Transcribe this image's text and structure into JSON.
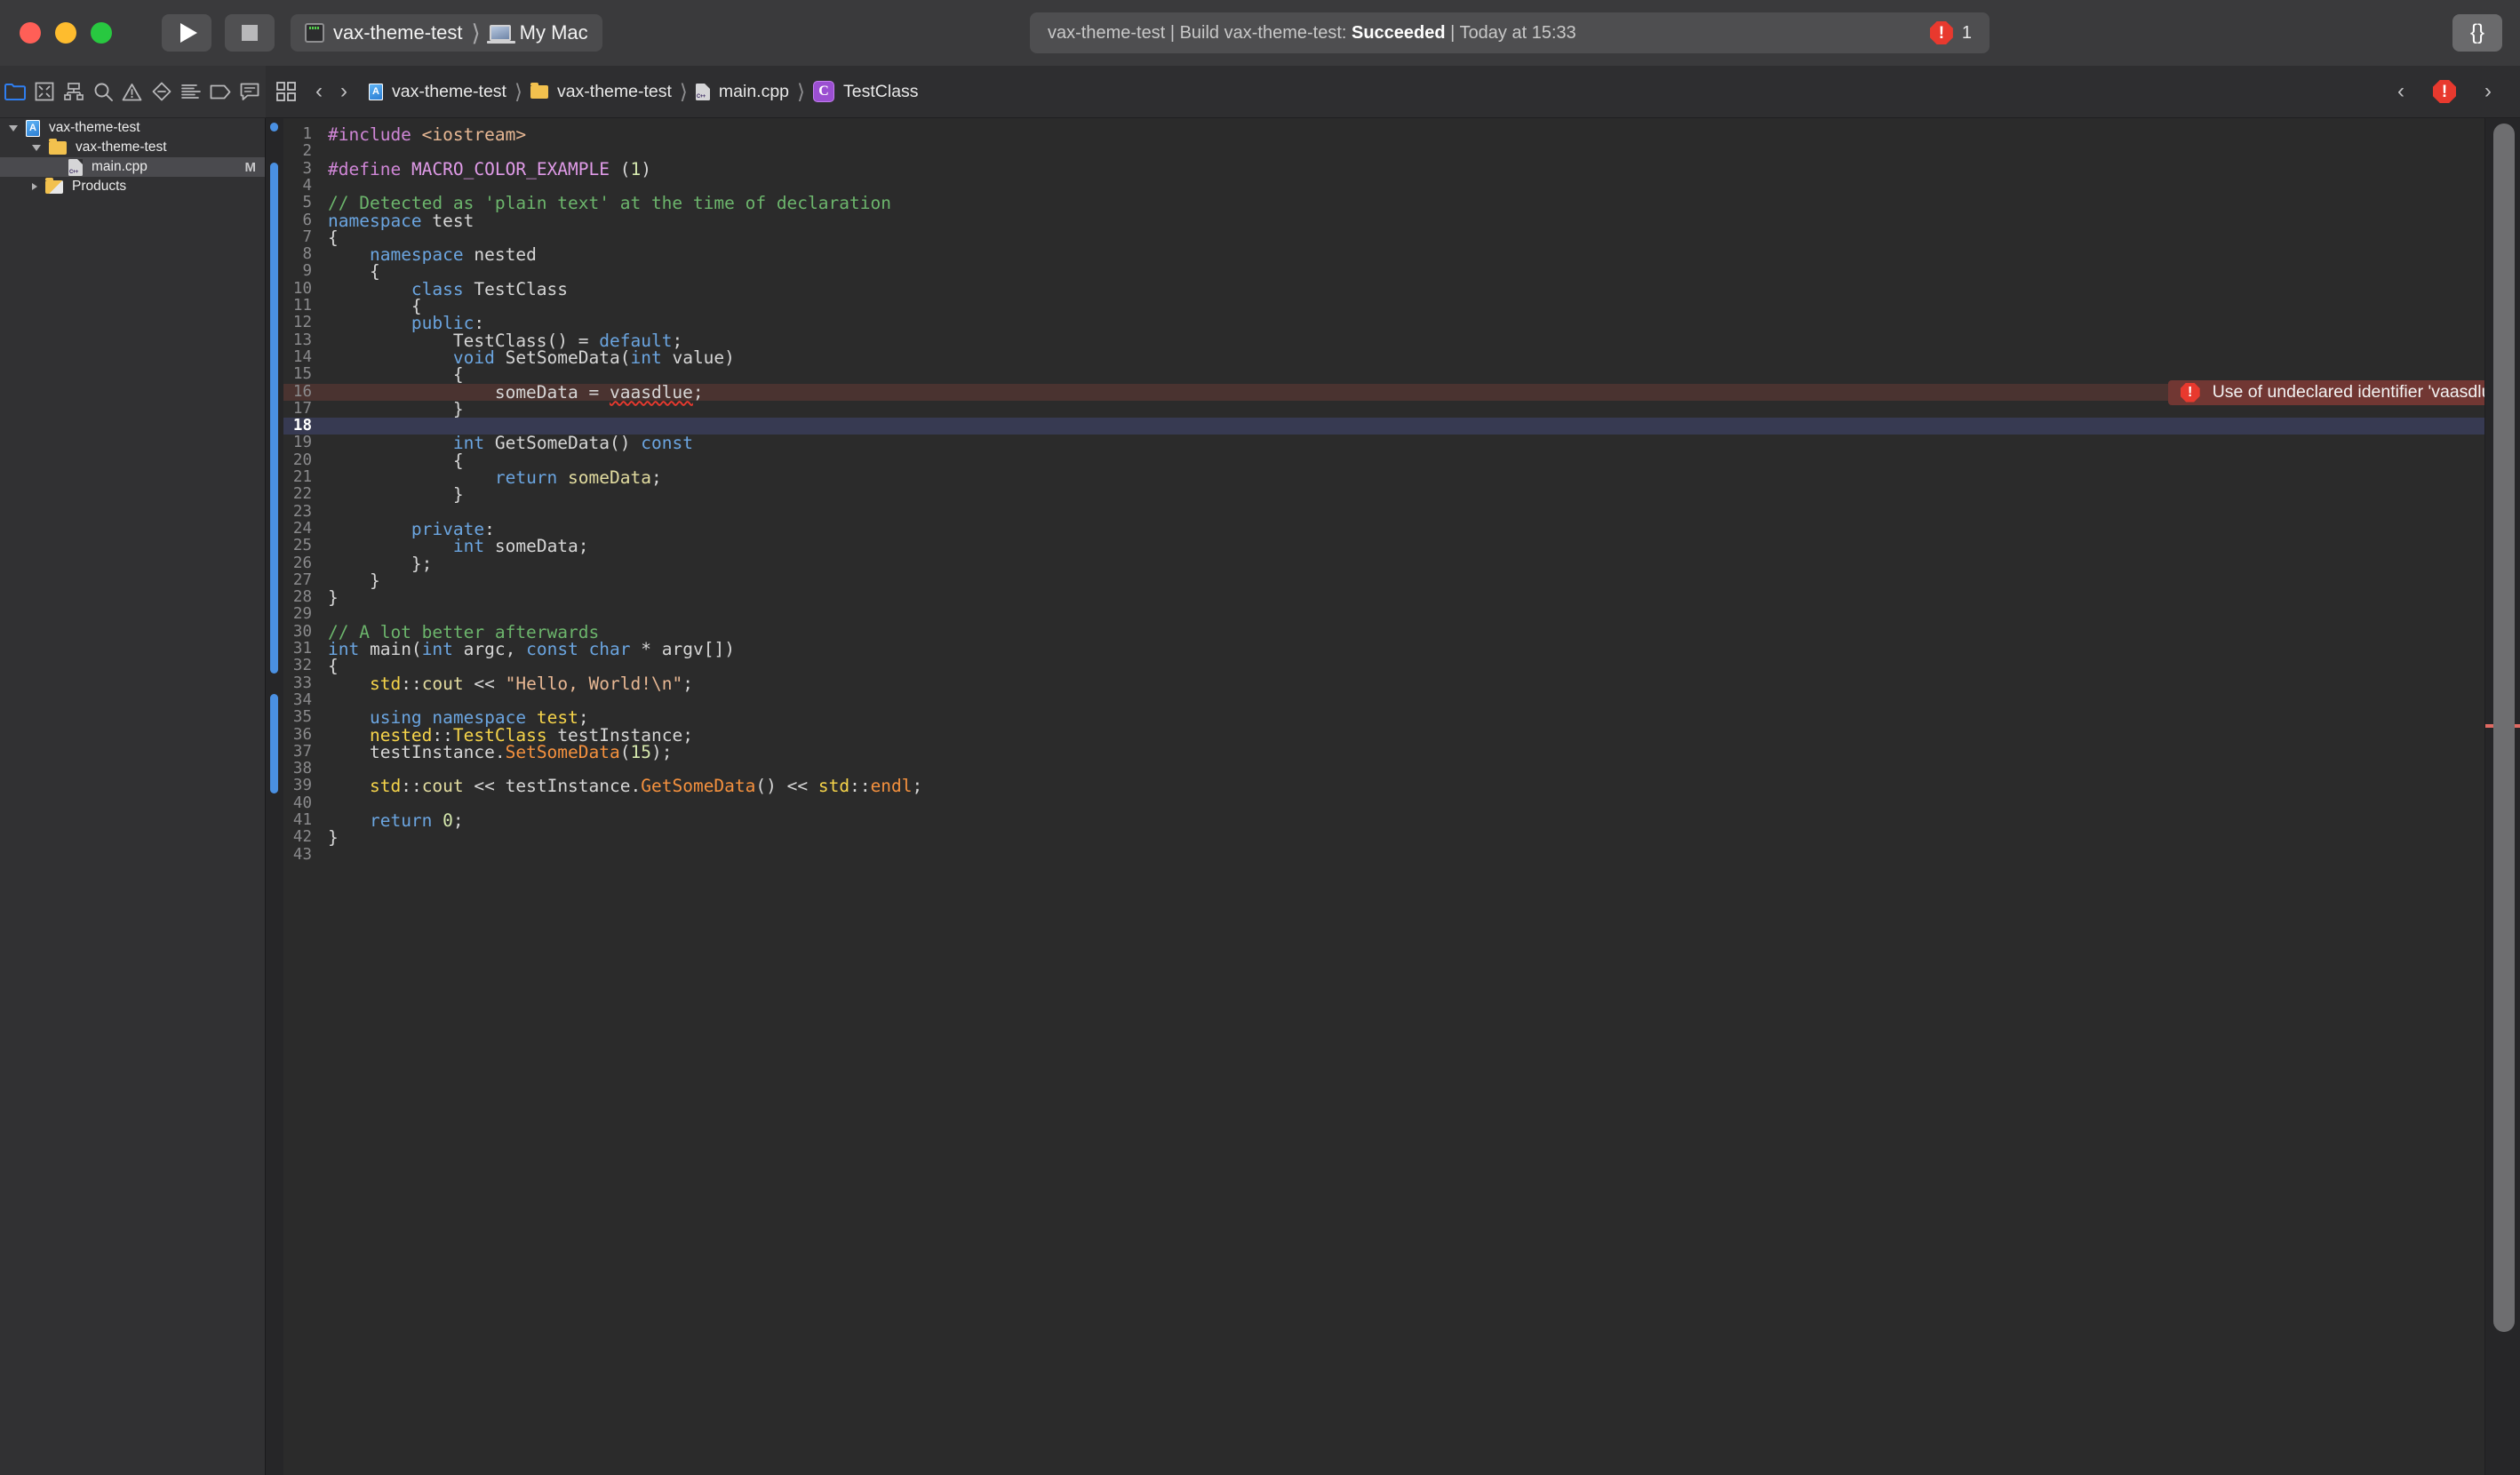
{
  "titlebar": {
    "run_label": "Run",
    "stop_label": "Stop",
    "scheme": "vax-theme-test",
    "scheme_separator": "⟩",
    "destination": "My Mac",
    "library_label": "{}"
  },
  "status": {
    "scheme": "vax-theme-test",
    "action": "Build vax-theme-test:",
    "result": "Succeeded",
    "time": "Today at 15:33",
    "error_count": "1",
    "error_glyph": "!"
  },
  "nav_toolbar": {
    "items": [
      {
        "icon": "folder-icon",
        "label": "Project navigator",
        "active": true
      },
      {
        "icon": "source-control-icon",
        "label": "Source control navigator",
        "active": false
      },
      {
        "icon": "symbol-navigator-icon",
        "label": "Symbol navigator",
        "active": false
      },
      {
        "icon": "search-icon",
        "label": "Find navigator",
        "active": false
      },
      {
        "icon": "warning-triangle-icon",
        "label": "Issue navigator",
        "active": false
      },
      {
        "icon": "test-diamond-icon",
        "label": "Test navigator",
        "active": false
      },
      {
        "icon": "debug-list-icon",
        "label": "Debug navigator",
        "active": false
      },
      {
        "icon": "breakpoint-tag-icon",
        "label": "Breakpoint navigator",
        "active": false
      },
      {
        "icon": "report-speech-icon",
        "label": "Report navigator",
        "active": false
      }
    ]
  },
  "navigator": {
    "items": [
      {
        "label": "vax-theme-test",
        "icon": "xcode-project-icon",
        "indent": 0,
        "disclosure": "open",
        "selected": false,
        "status": ""
      },
      {
        "label": "vax-theme-test",
        "icon": "folder-icon",
        "indent": 1,
        "disclosure": "open",
        "selected": false,
        "status": ""
      },
      {
        "label": "main.cpp",
        "icon": "cpp-file-icon",
        "indent": 2,
        "disclosure": "none",
        "selected": true,
        "status": "M"
      },
      {
        "label": "Products",
        "icon": "products-folder-icon",
        "indent": 1,
        "disclosure": "closed",
        "selected": false,
        "status": ""
      }
    ]
  },
  "jumpbar": {
    "related_items_label": "Related Items",
    "back_label": "‹",
    "forward_label": "›",
    "crumbs": [
      {
        "label": "vax-theme-test",
        "icon": "xcode-project-icon"
      },
      {
        "label": "vax-theme-test",
        "icon": "folder-icon"
      },
      {
        "label": "main.cpp",
        "icon": "cpp-file-icon"
      },
      {
        "label": "TestClass",
        "icon": "class-symbol-icon"
      }
    ],
    "separator": "⟩",
    "prev_issue_label": "‹",
    "next_issue_label": "›",
    "issue_glyph": "!"
  },
  "editor": {
    "error_message": "Use of undeclared identifier 'vaasdlue'",
    "error_glyph": "!",
    "current_line": 18,
    "error_line": 16,
    "total_lines": 43,
    "colors": {
      "background": "#2b2b2b",
      "keyword": "#6ba5e0",
      "preprocessor": "#cf86d6",
      "macro": "#e09be8",
      "string": "#e8b894",
      "comment": "#6cb56c",
      "number": "#d5e8ad",
      "type": "#f6d44a",
      "function": "#f5913e",
      "member": "#e2dca0",
      "plain": "#d6d6d6",
      "current_line_bg": "#373a52",
      "error_line_bg": "#4a3330",
      "change_bar": "#4a90e2"
    },
    "lines": [
      {
        "n": 1,
        "tokens": [
          [
            "pp",
            "#include"
          ],
          [
            "pl",
            " "
          ],
          [
            "str",
            "<iostream>"
          ]
        ]
      },
      {
        "n": 2,
        "tokens": []
      },
      {
        "n": 3,
        "tokens": [
          [
            "pp",
            "#define"
          ],
          [
            "pl",
            " "
          ],
          [
            "mac",
            "MACRO_COLOR_EXAMPLE"
          ],
          [
            "pl",
            " ("
          ],
          [
            "num",
            "1"
          ],
          [
            "pl",
            ")"
          ]
        ]
      },
      {
        "n": 4,
        "tokens": []
      },
      {
        "n": 5,
        "tokens": [
          [
            "cmt",
            "// Detected as 'plain text' at the time of declaration"
          ]
        ]
      },
      {
        "n": 6,
        "tokens": [
          [
            "k",
            "namespace"
          ],
          [
            "pl",
            " test"
          ]
        ]
      },
      {
        "n": 7,
        "tokens": [
          [
            "pl",
            "{"
          ]
        ]
      },
      {
        "n": 8,
        "tokens": [
          [
            "pl",
            "    "
          ],
          [
            "k",
            "namespace"
          ],
          [
            "pl",
            " nested"
          ]
        ]
      },
      {
        "n": 9,
        "tokens": [
          [
            "pl",
            "    {"
          ]
        ]
      },
      {
        "n": 10,
        "tokens": [
          [
            "pl",
            "        "
          ],
          [
            "k",
            "class"
          ],
          [
            "pl",
            " TestClass"
          ]
        ]
      },
      {
        "n": 11,
        "tokens": [
          [
            "pl",
            "        {"
          ]
        ]
      },
      {
        "n": 12,
        "tokens": [
          [
            "pl",
            "        "
          ],
          [
            "k",
            "public"
          ],
          [
            "pl",
            ":"
          ]
        ]
      },
      {
        "n": 13,
        "tokens": [
          [
            "pl",
            "            TestClass() = "
          ],
          [
            "k",
            "default"
          ],
          [
            "pl",
            ";"
          ]
        ]
      },
      {
        "n": 14,
        "tokens": [
          [
            "pl",
            "            "
          ],
          [
            "k",
            "void"
          ],
          [
            "pl",
            " SetSomeData("
          ],
          [
            "k",
            "int"
          ],
          [
            "pl",
            " value)"
          ]
        ]
      },
      {
        "n": 15,
        "tokens": [
          [
            "pl",
            "            {"
          ]
        ]
      },
      {
        "n": 16,
        "tokens": [
          [
            "pl",
            "                someData = "
          ],
          [
            "errsq",
            "vaasdlue"
          ],
          [
            "pl",
            ";"
          ]
        ]
      },
      {
        "n": 17,
        "tokens": [
          [
            "pl",
            "            }"
          ]
        ]
      },
      {
        "n": 18,
        "tokens": []
      },
      {
        "n": 19,
        "tokens": [
          [
            "pl",
            "            "
          ],
          [
            "k",
            "int"
          ],
          [
            "pl",
            " GetSomeData() "
          ],
          [
            "k",
            "const"
          ]
        ]
      },
      {
        "n": 20,
        "tokens": [
          [
            "pl",
            "            {"
          ]
        ]
      },
      {
        "n": 21,
        "tokens": [
          [
            "pl",
            "                "
          ],
          [
            "k",
            "return"
          ],
          [
            "pl",
            " "
          ],
          [
            "mem",
            "someData"
          ],
          [
            "pl",
            ";"
          ]
        ]
      },
      {
        "n": 22,
        "tokens": [
          [
            "pl",
            "            }"
          ]
        ]
      },
      {
        "n": 23,
        "tokens": []
      },
      {
        "n": 24,
        "tokens": [
          [
            "pl",
            "        "
          ],
          [
            "k",
            "private"
          ],
          [
            "pl",
            ":"
          ]
        ]
      },
      {
        "n": 25,
        "tokens": [
          [
            "pl",
            "            "
          ],
          [
            "k",
            "int"
          ],
          [
            "pl",
            " someData;"
          ]
        ]
      },
      {
        "n": 26,
        "tokens": [
          [
            "pl",
            "        };"
          ]
        ]
      },
      {
        "n": 27,
        "tokens": [
          [
            "pl",
            "    }"
          ]
        ]
      },
      {
        "n": 28,
        "tokens": [
          [
            "pl",
            "}"
          ]
        ]
      },
      {
        "n": 29,
        "tokens": []
      },
      {
        "n": 30,
        "tokens": [
          [
            "cmt",
            "// A lot better afterwards"
          ]
        ]
      },
      {
        "n": 31,
        "tokens": [
          [
            "k",
            "int"
          ],
          [
            "pl",
            " main("
          ],
          [
            "k",
            "int"
          ],
          [
            "pl",
            " argc, "
          ],
          [
            "k",
            "const"
          ],
          [
            "pl",
            " "
          ],
          [
            "k",
            "char"
          ],
          [
            "pl",
            " * argv[])"
          ]
        ]
      },
      {
        "n": 32,
        "tokens": [
          [
            "pl",
            "{"
          ]
        ]
      },
      {
        "n": 33,
        "tokens": [
          [
            "pl",
            "    "
          ],
          [
            "typ",
            "std"
          ],
          [
            "pl",
            "::"
          ],
          [
            "mem",
            "cout"
          ],
          [
            "pl",
            " << "
          ],
          [
            "str",
            "\"Hello, World!\\n\""
          ],
          [
            "pl",
            ";"
          ]
        ]
      },
      {
        "n": 34,
        "tokens": []
      },
      {
        "n": 35,
        "tokens": [
          [
            "pl",
            "    "
          ],
          [
            "k",
            "using"
          ],
          [
            "pl",
            " "
          ],
          [
            "k",
            "namespace"
          ],
          [
            "pl",
            " "
          ],
          [
            "typ",
            "test"
          ],
          [
            "pl",
            ";"
          ]
        ]
      },
      {
        "n": 36,
        "tokens": [
          [
            "pl",
            "    "
          ],
          [
            "typ",
            "nested"
          ],
          [
            "pl",
            "::"
          ],
          [
            "typ",
            "TestClass"
          ],
          [
            "pl",
            " testInstance;"
          ]
        ]
      },
      {
        "n": 37,
        "tokens": [
          [
            "pl",
            "    testInstance."
          ],
          [
            "fn",
            "SetSomeData"
          ],
          [
            "pl",
            "("
          ],
          [
            "num",
            "15"
          ],
          [
            "pl",
            ");"
          ]
        ]
      },
      {
        "n": 38,
        "tokens": []
      },
      {
        "n": 39,
        "tokens": [
          [
            "pl",
            "    "
          ],
          [
            "typ",
            "std"
          ],
          [
            "pl",
            "::"
          ],
          [
            "mem",
            "cout"
          ],
          [
            "pl",
            " << testInstance."
          ],
          [
            "fn",
            "GetSomeData"
          ],
          [
            "pl",
            "() << "
          ],
          [
            "typ",
            "std"
          ],
          [
            "pl",
            "::"
          ],
          [
            "fn",
            "endl"
          ],
          [
            "pl",
            ";"
          ]
        ]
      },
      {
        "n": 40,
        "tokens": []
      },
      {
        "n": 41,
        "tokens": [
          [
            "pl",
            "    "
          ],
          [
            "k",
            "return"
          ],
          [
            "pl",
            " "
          ],
          [
            "num",
            "0"
          ],
          [
            "pl",
            ";"
          ]
        ]
      },
      {
        "n": 42,
        "tokens": [
          [
            "pl",
            "}"
          ]
        ]
      },
      {
        "n": 43,
        "tokens": []
      }
    ],
    "change_bars": [
      {
        "from_line": 1,
        "to_line": 1,
        "dot": true
      },
      {
        "from_line": 3,
        "to_line": 32,
        "dot": false
      },
      {
        "from_line": 34,
        "to_line": 39,
        "dot": false
      }
    ]
  }
}
